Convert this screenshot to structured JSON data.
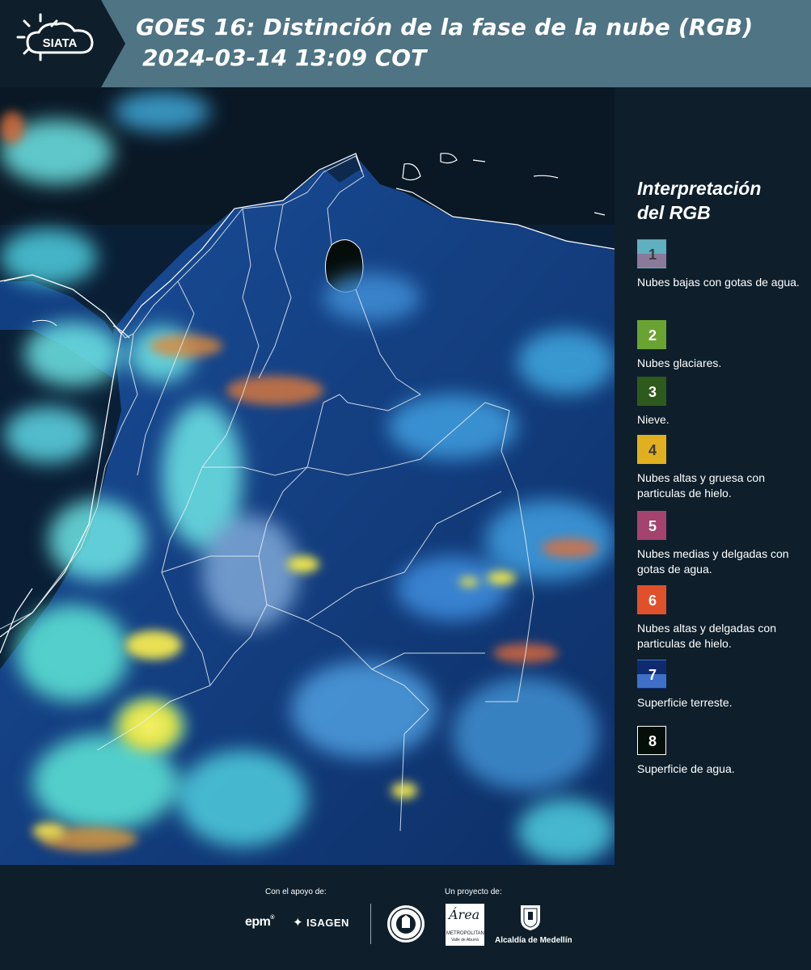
{
  "header": {
    "logo_text": "SIATA",
    "title": "GOES 16: Distinción de la fase de la nube (RGB)",
    "timestamp": "2024-03-14 13:09 COT",
    "background_color": "#4f7484"
  },
  "legend": {
    "title_line1": "Interpretación",
    "title_line2": "del RGB",
    "items": [
      {
        "number": "1",
        "label": "Nubes bajas con gotas de agua.",
        "color_top": "#5fb0c0",
        "color_bottom": "#8a7a9a"
      },
      {
        "number": "2",
        "label": "Nubes glaciares.",
        "color_top": "#6aa332",
        "color_bottom": "#6aa332"
      },
      {
        "number": "3",
        "label": "Nieve.",
        "color_top": "#2e5a1c",
        "color_bottom": "#2e5a1c"
      },
      {
        "number": "4",
        "label": "Nubes altas y gruesa con particulas de hielo.",
        "color_top": "#e0b020",
        "color_bottom": "#e0b020"
      },
      {
        "number": "5",
        "label": "Nubes medias y delgadas con gotas de agua.",
        "color_top": "#a4436e",
        "color_bottom": "#a4436e"
      },
      {
        "number": "6",
        "label": "Nubes altas y delgadas con particulas de hielo.",
        "color_top": "#e0502a",
        "color_bottom": "#e0502a"
      },
      {
        "number": "7",
        "label": "Superficie terreste.",
        "color_top": "#0f2a6e",
        "color_bottom": "#3f70c8"
      },
      {
        "number": "8",
        "label": "Superficie de agua.",
        "color_top": "#050f0a",
        "color_bottom": "#050f0a"
      }
    ]
  },
  "footer": {
    "support_label": "Con el apoyo de:",
    "project_label": "Un proyecto de:",
    "sponsors": [
      "epm",
      "ISAGEN"
    ],
    "partner_area": "Área",
    "partner_area_sub": "METROPOLITANA",
    "partner_area_sub2": "Valle de Aburrá",
    "partner_alcaldia": "Alcaldía de Medellín"
  },
  "map": {
    "icon": "satellite-rgb-image",
    "land_color": "#0f3e82",
    "sea_color": "#0a1e36",
    "cloud_cyan": "#5fe8e8",
    "cloud_yellow": "#f2e84a",
    "cloud_orange": "#e07a3a"
  }
}
